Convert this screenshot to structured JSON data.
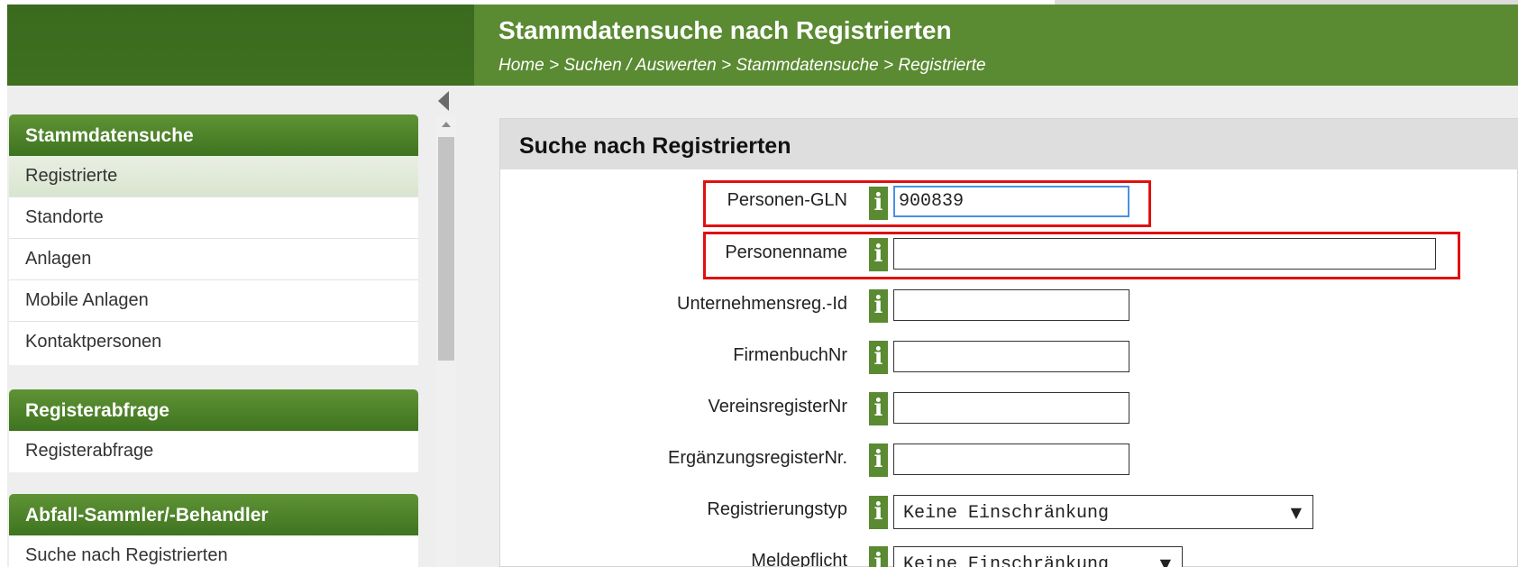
{
  "header": {
    "title": "Stammdatensuche nach Registrierten",
    "breadcrumb": "Home > Suchen / Auswerten > Stammdatensuche > Registrierte"
  },
  "sidebar": {
    "groups": [
      {
        "title": "Stammdatensuche",
        "items": [
          "Registrierte",
          "Standorte",
          "Anlagen",
          "Mobile Anlagen",
          "Kontaktpersonen"
        ]
      },
      {
        "title": "Registerabfrage",
        "items": [
          "Registerabfrage"
        ]
      },
      {
        "title": "Abfall-Sammler/-Behandler",
        "items": [
          "Suche nach Registrierten"
        ]
      }
    ],
    "active_item": "Registrierte"
  },
  "panel": {
    "title": "Suche nach Registrierten"
  },
  "form": {
    "fields": [
      {
        "label": "Personen-GLN",
        "value": "900839"
      },
      {
        "label": "Personenname",
        "value": ""
      },
      {
        "label": "Unternehmensreg.-Id",
        "value": ""
      },
      {
        "label": "FirmenbuchNr",
        "value": ""
      },
      {
        "label": "VereinsregisterNr",
        "value": ""
      },
      {
        "label": "ErgänzungsregisterNr.",
        "value": ""
      },
      {
        "label": "Registrierungstyp",
        "value": "Keine Einschränkung"
      },
      {
        "label": "Meldepflicht",
        "value": "Keine Einschränkung"
      }
    ],
    "info_glyph": "i",
    "dropdown_arrow": "▼"
  },
  "colors": {
    "header_green": "#5a8a32",
    "header_dark_green": "#3a6a1e",
    "highlight_red": "#e01010",
    "focus_blue": "#4a90e2"
  }
}
